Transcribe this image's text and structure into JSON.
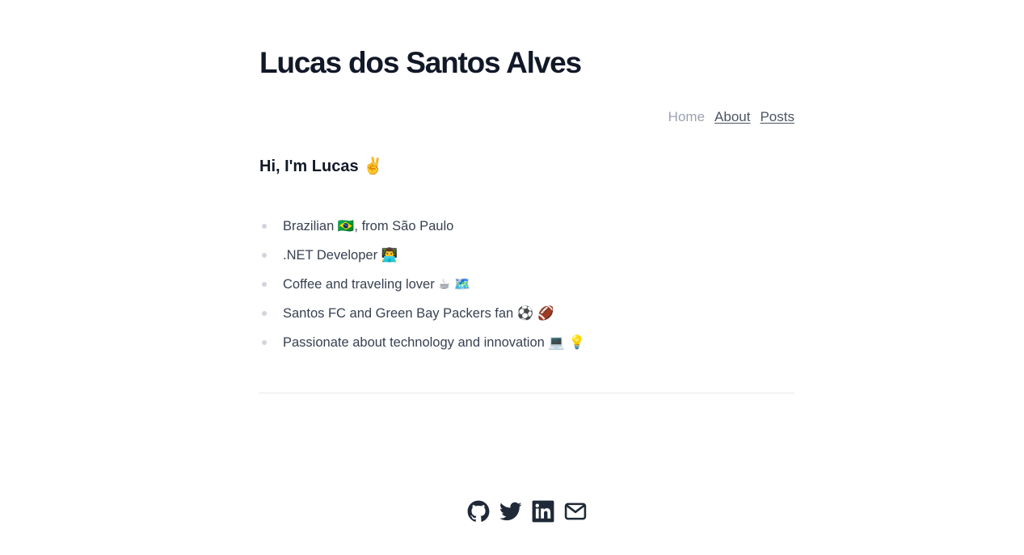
{
  "site": {
    "title": "Lucas dos Santos Alves"
  },
  "nav": {
    "items": [
      {
        "label": "Home",
        "current": true
      },
      {
        "label": "About",
        "current": false
      },
      {
        "label": "Posts",
        "current": false
      }
    ]
  },
  "main": {
    "greeting": "Hi, I'm Lucas ✌️",
    "facts": [
      "Brazilian 🇧🇷, from São Paulo",
      ".NET Developer 👨‍💻",
      "Coffee and traveling lover ☕ 🗺️",
      "Santos FC and Green Bay Packers fan ⚽ 🏈",
      "Passionate about technology and innovation 💻 💡"
    ]
  },
  "social": {
    "icons": [
      "github-icon",
      "twitter-icon",
      "linkedin-icon",
      "mail-icon"
    ]
  }
}
